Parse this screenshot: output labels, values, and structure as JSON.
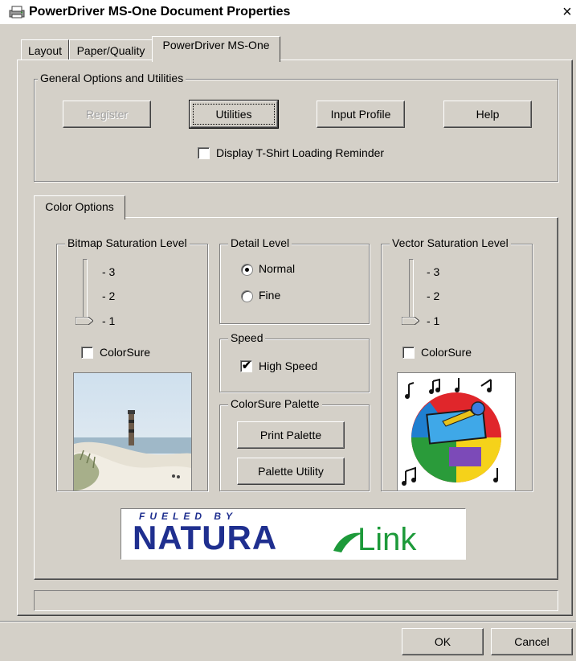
{
  "window": {
    "title": "PowerDriver MS-One Document Properties",
    "close_glyph": "×"
  },
  "tabs": [
    {
      "label": "Layout"
    },
    {
      "label": "Paper/Quality"
    },
    {
      "label": "PowerDriver MS-One",
      "active": true
    }
  ],
  "general": {
    "legend": "General Options and Utilities",
    "register_label": "Register",
    "utilities_label": "Utilities",
    "input_profile_label": "Input Profile",
    "help_label": "Help",
    "tshirt_reminder_label": "Display T-Shirt Loading Reminder",
    "tshirt_reminder_checked": false
  },
  "color_tab": {
    "label": "Color Options"
  },
  "bitmap": {
    "legend": "Bitmap Saturation Level",
    "ticks": [
      "- 3",
      "- 2",
      "- 1"
    ],
    "level": 1,
    "colorsure_label": "ColorSure",
    "colorsure_checked": false
  },
  "detail": {
    "legend": "Detail Level",
    "options": [
      "Normal",
      "Fine"
    ],
    "selected": "Normal"
  },
  "speed": {
    "legend": "Speed",
    "high_speed_label": "High Speed",
    "high_speed_checked": true
  },
  "palette": {
    "legend": "ColorSure Palette",
    "print_palette_label": "Print Palette",
    "palette_utility_label": "Palette Utility"
  },
  "vector": {
    "legend": "Vector Saturation Level",
    "ticks": [
      "- 3",
      "- 2",
      "- 1"
    ],
    "level": 1,
    "colorsure_label": "ColorSure",
    "colorsure_checked": false
  },
  "logo": {
    "fueled_by": "FUELED BY",
    "brand_left": "NATURA",
    "brand_right": "Link"
  },
  "footer": {
    "ok_label": "OK",
    "cancel_label": "Cancel"
  },
  "icons": {
    "title_icon": "printer-icon",
    "close_icon": "close-icon"
  },
  "colors": {
    "face": "#d4d0c8",
    "logo_blue": "#1f2f8f",
    "logo_green": "#1d9a3a"
  }
}
